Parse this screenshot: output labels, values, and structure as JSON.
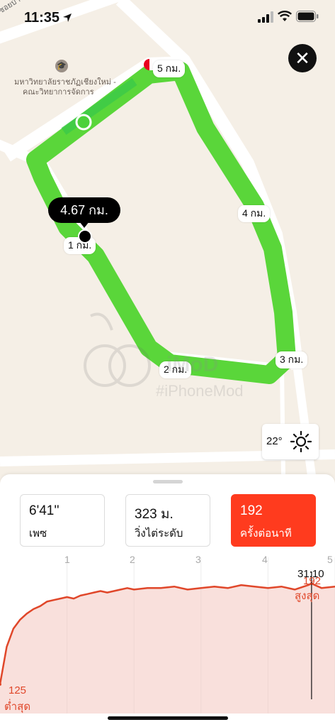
{
  "status_bar": {
    "time": "11:35"
  },
  "map": {
    "street_label": "ซอยบ้านแม่ลามัย",
    "poi_name_line1": "มหาวิทยาลัยราชภัฏเชียงใหม่ -",
    "poi_name_line2": "คณะวิทยาการจัดการ",
    "km_markers": [
      "1 กม.",
      "2 กม.",
      "3 กม.",
      "4 กม.",
      "5 กม."
    ],
    "selected_distance": "4.67 กม.",
    "weather_temp": "22°",
    "watermark_title": "iMoD",
    "watermark_sub": "#iPhoneMod",
    "route_color": "#5ad63a"
  },
  "stats": [
    {
      "value": "6'41''",
      "label": "เพซ",
      "active": false
    },
    {
      "value": "323 ม.",
      "label": "วิ่งไต่ระดับ",
      "active": false
    },
    {
      "value": "192",
      "label": "ครั้งต่อนาที",
      "active": true
    }
  ],
  "chart_data": {
    "type": "line",
    "x_ticks": [
      "1",
      "2",
      "3",
      "4",
      "5"
    ],
    "xlim": [
      0,
      5
    ],
    "ylim": [
      115,
      200
    ],
    "cursor_time": "31:10",
    "max_value": "192",
    "max_label": "สูงสุด",
    "min_value": "125",
    "min_label": "ต่ำสุด",
    "series": [
      {
        "color": "#e0472a",
        "x": [
          0,
          0.1,
          0.2,
          0.3,
          0.4,
          0.5,
          0.6,
          0.7,
          0.8,
          0.9,
          1.0,
          1.1,
          1.2,
          1.3,
          1.4,
          1.5,
          1.6,
          1.7,
          1.8,
          1.9,
          2.0,
          2.2,
          2.4,
          2.6,
          2.8,
          3.0,
          3.2,
          3.4,
          3.6,
          3.8,
          4.0,
          4.2,
          4.4,
          4.6,
          4.65,
          4.8,
          5.0
        ],
        "values": [
          125,
          150,
          162,
          168,
          172,
          175,
          177,
          180,
          181,
          182,
          183,
          182,
          184,
          185,
          186,
          187,
          186,
          187,
          188,
          189,
          188,
          189,
          189,
          190,
          188,
          189,
          190,
          189,
          191,
          190,
          189,
          190,
          188,
          191,
          192,
          189,
          190
        ]
      }
    ]
  },
  "colors": {
    "accent": "#ff3b1e",
    "hr_line": "#e0472a",
    "route": "#5ad63a"
  }
}
